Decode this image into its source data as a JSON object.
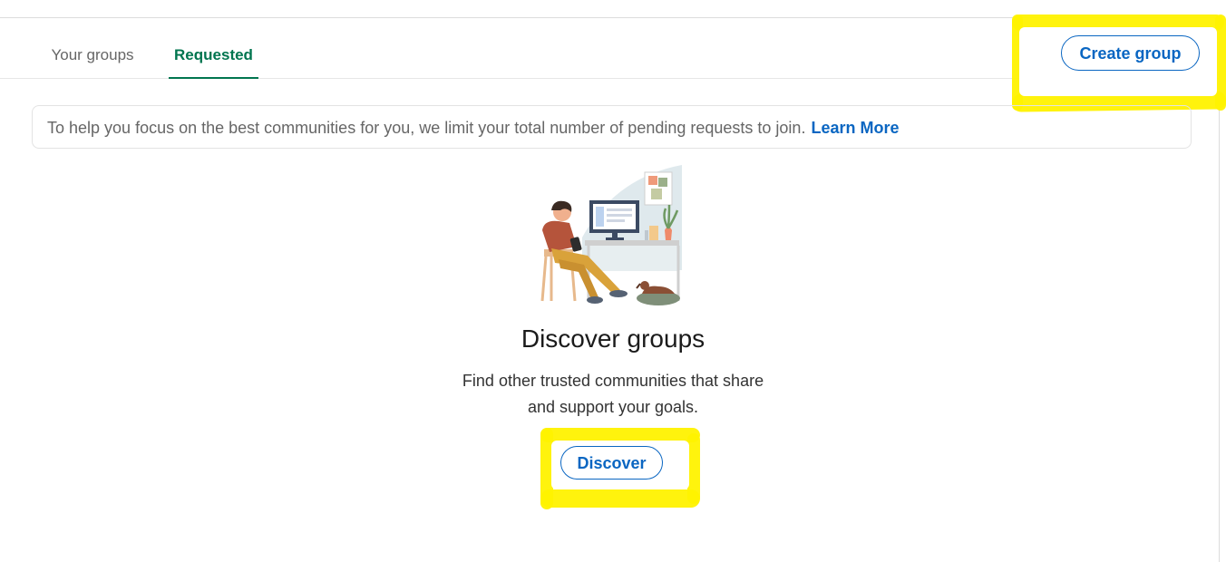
{
  "tabs": [
    {
      "label": "Your groups",
      "active": false
    },
    {
      "label": "Requested",
      "active": true
    }
  ],
  "toolbar": {
    "create_label": "Create group"
  },
  "notice": {
    "text": "To help you focus on the best communities for you, we limit your total number of pending requests to join.",
    "link": "Learn More"
  },
  "empty_state": {
    "title": "Discover groups",
    "line1": "Find other trusted communities that share",
    "line2": "and support your goals.",
    "button": "Discover"
  },
  "colors": {
    "accent": "#0a66c2",
    "active_tab": "#01754f",
    "highlight": "#fff200"
  },
  "icons": [
    "person-at-desk-illustration"
  ]
}
